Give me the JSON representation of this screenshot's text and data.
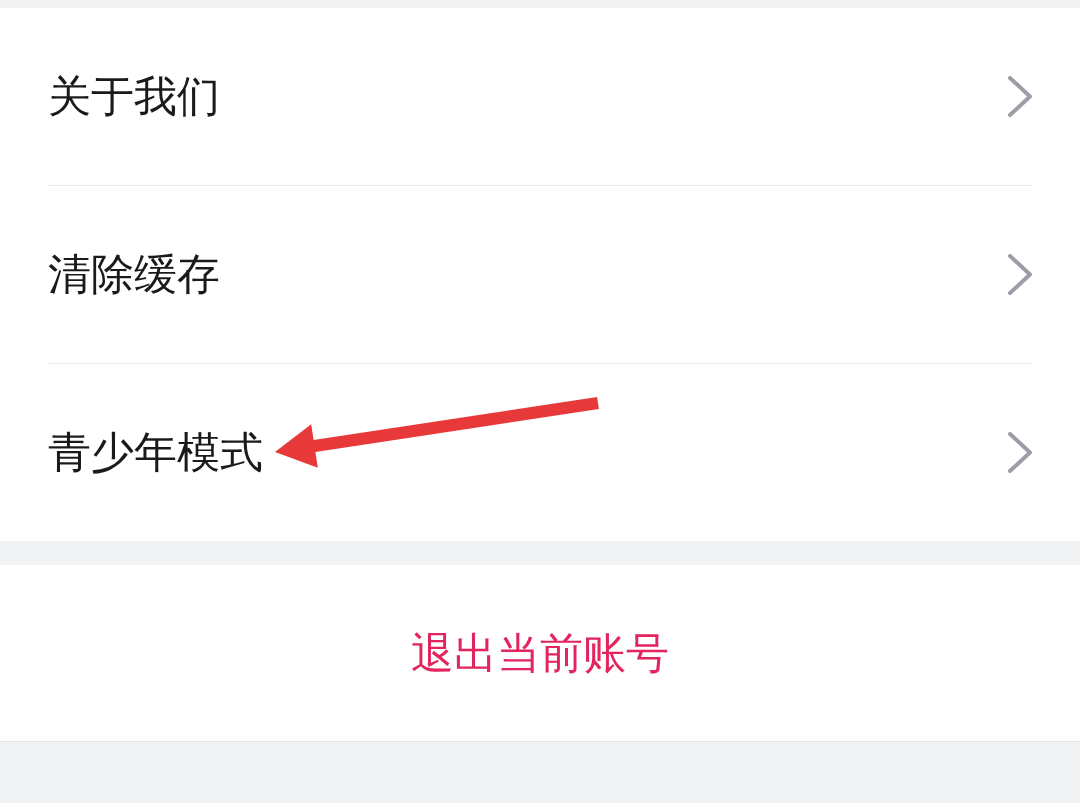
{
  "menu_items": [
    {
      "label": "关于我们"
    },
    {
      "label": "清除缓存"
    },
    {
      "label": "青少年模式"
    }
  ],
  "logout_button": {
    "label": "退出当前账号"
  }
}
